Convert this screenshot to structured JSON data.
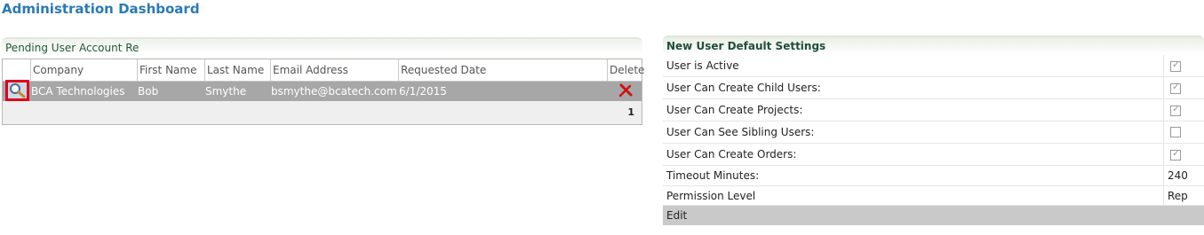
{
  "page": {
    "title": "Administration Dashboard"
  },
  "pending": {
    "title": "Pending User Account Re",
    "columns": [
      "Company",
      "First Name",
      "Last Name",
      "Email Address",
      "Requested Date",
      "Delete"
    ],
    "rows": [
      {
        "company": "BCA Technologies",
        "first_name": "Bob",
        "last_name": "Smythe",
        "email": "bsmythe@bcatech.com",
        "requested_date": "6/1/2015"
      }
    ],
    "pager": {
      "current_page": "1"
    }
  },
  "settings": {
    "title": "New User Default Settings",
    "rows": [
      {
        "label": "User is Active",
        "checked": true
      },
      {
        "label": "User Can Create Child Users:",
        "checked": true
      },
      {
        "label": "User Can Create Projects:",
        "checked": true
      },
      {
        "label": "User Can See Sibling Users:",
        "checked": false
      },
      {
        "label": "User Can Create Orders:",
        "checked": true
      },
      {
        "label": "Timeout Minutes:",
        "value": "240"
      },
      {
        "label": "Permission Level",
        "value": "Rep"
      }
    ],
    "edit_label": "Edit"
  },
  "icons": {
    "view": "magnifier-icon",
    "delete": "red-x-icon"
  }
}
